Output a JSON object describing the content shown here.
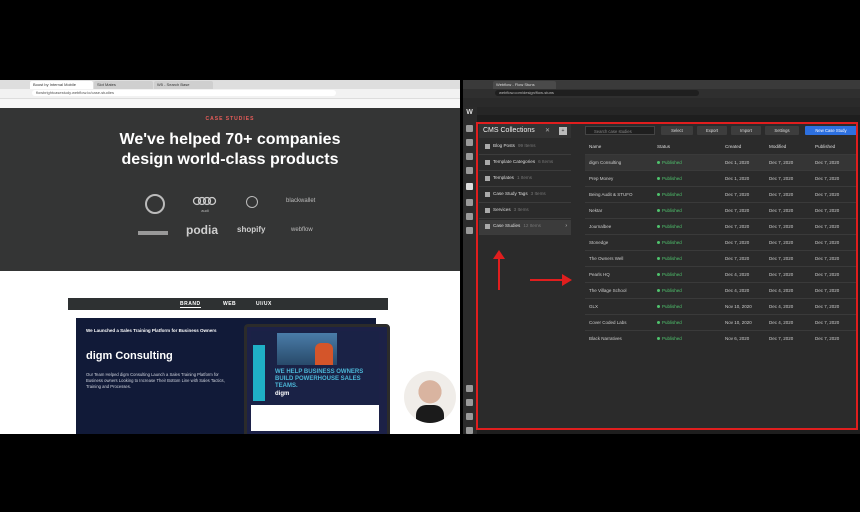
{
  "left_browser": {
    "tabs": [
      "Boost by Internal Mobile",
      "Slot Mates",
      "W5 - Search Base"
    ],
    "url": "flowbrightcasestudy.webflow.io/case-studies",
    "hero": {
      "kicker": "CASE STUDIES",
      "headline": "We've helped 70+ companies design world-class products",
      "logos": [
        "audi",
        "blackwallet",
        "podia",
        "shopify",
        "webflow"
      ]
    },
    "card": {
      "tabs": [
        "BRAND",
        "WEB",
        "UI/UX"
      ],
      "active_tab": "BRAND",
      "small_title": "We Launched a Sales Training Platform for Business Owners",
      "title": "digm Consulting",
      "description": "Our Team Helped digm Consulting Launch a Sales Training Platform for Business owners Looking to Increase Their Bottom Line with Sales Tactics, Training and Processes.",
      "tablet_text": "WE HELP BUSINESS OWNERS BUILD POWERHOUSE SALES TEAMS.",
      "tablet_logo": "digm"
    }
  },
  "right_browser": {
    "tabs": [
      "Webflow - Flow Stuns"
    ],
    "url": "webflow.com/design/flow-stuns",
    "cms": {
      "title": "CMS Collections",
      "collections": [
        {
          "name": "Blog Posts",
          "count": "99 Items"
        },
        {
          "name": "Template Categories",
          "count": "6 Items"
        },
        {
          "name": "Templates",
          "count": "1 Items"
        },
        {
          "name": "Case Study Tags",
          "count": "3 Items"
        },
        {
          "name": "Services",
          "count": "3 Items"
        },
        {
          "name": "Case Studies",
          "count": "12 Items",
          "active": true
        }
      ],
      "search_placeholder": "Search case studies",
      "buttons": {
        "select": "Select",
        "export": "Export",
        "import": "Import",
        "settings": "Settings",
        "new": "New Case Study"
      },
      "columns": [
        "Name",
        "Status",
        "Created",
        "Modified",
        "Published"
      ],
      "rows": [
        {
          "name": "digm Consulting",
          "status": "Published",
          "created": "Dec 1, 2020",
          "modified": "Dec 7, 2020",
          "published": "Dec 7, 2020"
        },
        {
          "name": "Prep Money",
          "status": "Published",
          "created": "Dec 1, 2020",
          "modified": "Dec 7, 2020",
          "published": "Dec 7, 2020"
        },
        {
          "name": "Being Audit & STUFO",
          "status": "Published",
          "created": "Dec 7, 2020",
          "modified": "Dec 7, 2020",
          "published": "Dec 7, 2020"
        },
        {
          "name": "Nektar",
          "status": "Published",
          "created": "Dec 7, 2020",
          "modified": "Dec 7, 2020",
          "published": "Dec 7, 2020"
        },
        {
          "name": "Journalbee",
          "status": "Published",
          "created": "Dec 7, 2020",
          "modified": "Dec 7, 2020",
          "published": "Dec 7, 2020"
        },
        {
          "name": "Stonedge",
          "status": "Published",
          "created": "Dec 7, 2020",
          "modified": "Dec 7, 2020",
          "published": "Dec 7, 2020"
        },
        {
          "name": "The Owners Well",
          "status": "Published",
          "created": "Dec 7, 2020",
          "modified": "Dec 7, 2020",
          "published": "Dec 7, 2020"
        },
        {
          "name": "Pearls HQ",
          "status": "Published",
          "created": "Dec 4, 2020",
          "modified": "Dec 7, 2020",
          "published": "Dec 7, 2020"
        },
        {
          "name": "The Village School",
          "status": "Published",
          "created": "Dec 4, 2020",
          "modified": "Dec 4, 2020",
          "published": "Dec 7, 2020"
        },
        {
          "name": "GLX",
          "status": "Published",
          "created": "Nov 10, 2020",
          "modified": "Dec 4, 2020",
          "published": "Dec 7, 2020"
        },
        {
          "name": "Cover Coded Labs",
          "status": "Published",
          "created": "Nov 10, 2020",
          "modified": "Dec 4, 2020",
          "published": "Dec 7, 2020"
        },
        {
          "name": "Black Narratives",
          "status": "Published",
          "created": "Nov 6, 2020",
          "modified": "Dec 7, 2020",
          "published": "Dec 7, 2020"
        }
      ]
    }
  },
  "colors": {
    "annotation_red": "#e01e1e",
    "published_green": "#4fc36d",
    "accent_blue": "#2d70e0",
    "kicker_red": "#e85d5a"
  }
}
